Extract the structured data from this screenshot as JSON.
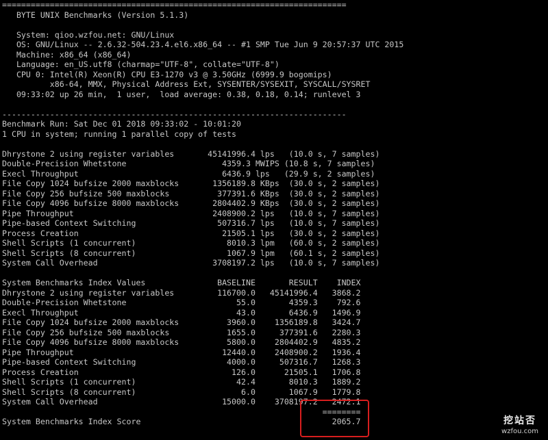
{
  "terminal": {
    "lines": [
      "========================================================================",
      "   BYTE UNIX Benchmarks (Version 5.1.3)",
      "",
      "   System: qioo.wzfou.net: GNU/Linux",
      "   OS: GNU/Linux -- 2.6.32-504.23.4.el6.x86_64 -- #1 SMP Tue Jun 9 20:57:37 UTC 2015",
      "   Machine: x86_64 (x86_64)",
      "   Language: en_US.utf8 (charmap=\"UTF-8\", collate=\"UTF-8\")",
      "   CPU 0: Intel(R) Xeon(R) CPU E3-1270 v3 @ 3.50GHz (6999.9 bogomips)",
      "          x86-64, MMX, Physical Address Ext, SYSENTER/SYSEXIT, SYSCALL/SYSRET",
      "   09:33:02 up 26 min,  1 user,  load average: 0.38, 0.18, 0.14; runlevel 3",
      "",
      "------------------------------------------------------------------------",
      "Benchmark Run: Sat Dec 01 2018 09:33:02 - 10:01:20",
      "1 CPU in system; running 1 parallel copy of tests",
      "",
      "Dhrystone 2 using register variables       45141996.4 lps   (10.0 s, 7 samples)",
      "Double-Precision Whetstone                    4359.3 MWIPS (10.8 s, 7 samples)",
      "Execl Throughput                              6436.9 lps   (29.9 s, 2 samples)",
      "File Copy 1024 bufsize 2000 maxblocks       1356189.8 KBps  (30.0 s, 2 samples)",
      "File Copy 256 bufsize 500 maxblocks          377391.6 KBps  (30.0 s, 2 samples)",
      "File Copy 4096 bufsize 8000 maxblocks       2804402.9 KBps  (30.0 s, 2 samples)",
      "Pipe Throughput                             2408900.2 lps   (10.0 s, 7 samples)",
      "Pipe-based Context Switching                 507316.7 lps   (10.0 s, 7 samples)",
      "Process Creation                              21505.1 lps   (30.0 s, 2 samples)",
      "Shell Scripts (1 concurrent)                   8010.3 lpm   (60.0 s, 2 samples)",
      "Shell Scripts (8 concurrent)                   1067.9 lpm   (60.1 s, 2 samples)",
      "System Call Overhead                        3708197.2 lps   (10.0 s, 7 samples)",
      "",
      "System Benchmarks Index Values               BASELINE       RESULT    INDEX",
      "Dhrystone 2 using register variables         116700.0   45141996.4   3868.2",
      "Double-Precision Whetstone                       55.0       4359.3    792.6",
      "Execl Throughput                                 43.0       6436.9   1496.9",
      "File Copy 1024 bufsize 2000 maxblocks          3960.0    1356189.8   3424.7",
      "File Copy 256 bufsize 500 maxblocks            1655.0     377391.6   2280.3",
      "File Copy 4096 bufsize 8000 maxblocks          5800.0    2804402.9   4835.2",
      "Pipe Throughput                               12440.0    2408900.2   1936.4",
      "Pipe-based Context Switching                   4000.0     507316.7   1268.3",
      "Process Creation                                126.0      21505.1   1706.8",
      "Shell Scripts (1 concurrent)                     42.4       8010.3   1889.2",
      "Shell Scripts (8 concurrent)                      6.0       1067.9   1779.8",
      "System Call Overhead                          15000.0    3708197.2   2472.1",
      "                                                                   ========",
      "System Benchmarks Index Score                                        2065.7"
    ]
  },
  "watermark": {
    "logo_text": "挖站否",
    "domain_text": "wzfou.com"
  },
  "colors": {
    "background": "#000000",
    "text": "#c8c8c8",
    "highlight": "#d81e1e"
  }
}
